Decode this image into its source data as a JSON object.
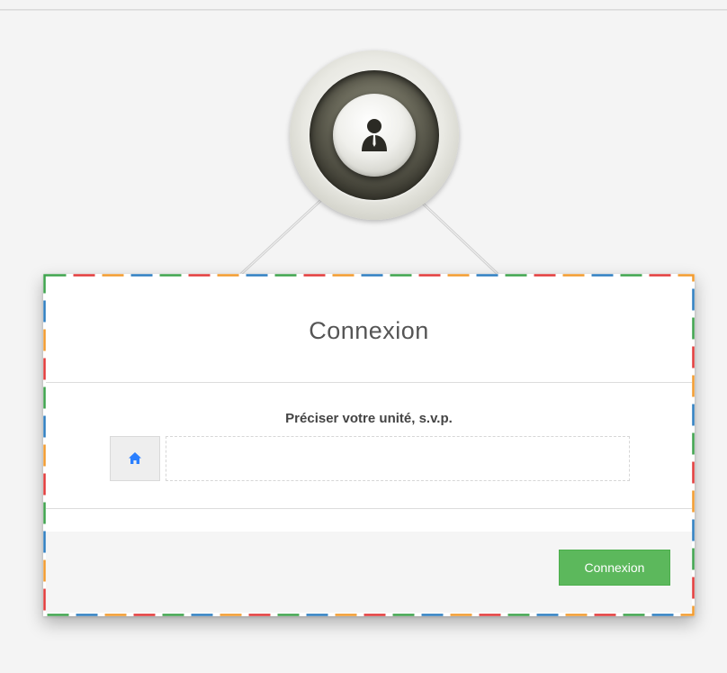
{
  "login": {
    "title": "Connexion",
    "prompt": "Préciser votre unité, s.v.p.",
    "unit_input": {
      "value": "",
      "placeholder": ""
    },
    "submit_label": "Connexion"
  },
  "icons": {
    "avatar": "user-icon",
    "unit_addon": "home-icon"
  },
  "colors": {
    "submit_button": "#5cb85c",
    "home_icon": "#2a7fff",
    "border_dashes": [
      "#3fa34d",
      "#e23b3b",
      "#f29b2f",
      "#2f7fc1"
    ]
  }
}
